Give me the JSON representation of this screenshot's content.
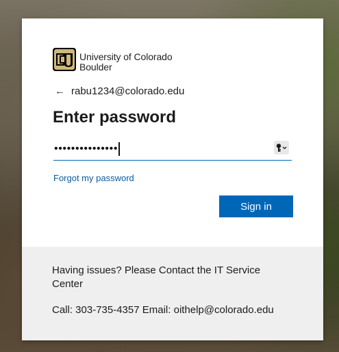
{
  "brand": {
    "name_line1": "University of Colorado",
    "name_line2": "Boulder",
    "logo_icon": "cu-logo-icon",
    "gold": "#cfb87c",
    "black": "#000000"
  },
  "identity": {
    "back_icon": "arrow-left-icon",
    "back_glyph": "←",
    "email": "rabu1234@colorado.edu"
  },
  "title": "Enter password",
  "password": {
    "masked_value": "•••••••••••••••",
    "reveal_icon": "key-icon"
  },
  "links": {
    "forgot_password": "Forgot my password"
  },
  "buttons": {
    "sign_in": "Sign in"
  },
  "footer": {
    "issues_text": "Having issues? Please Contact the IT Service Center",
    "contact_text": "Call: 303-735-4357 Email: oithelp@colorado.edu"
  },
  "colors": {
    "accent": "#0067b8",
    "link": "#0a5a9c",
    "footer_bg": "#efefef"
  }
}
